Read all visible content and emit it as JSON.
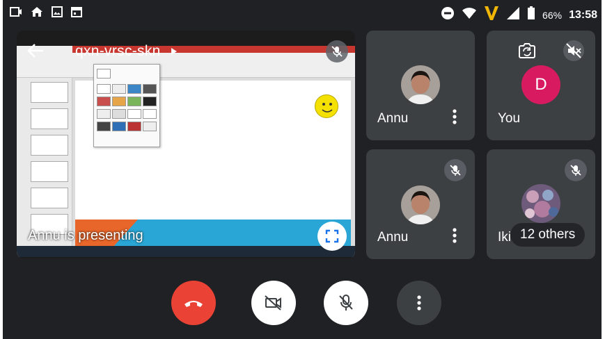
{
  "status_bar": {
    "left_icons": [
      "cast-icon",
      "home-icon",
      "gallery-icon",
      "calendar-icon"
    ],
    "right_icons": [
      "do-not-disturb-icon",
      "wifi-icon",
      "vpn-v-icon",
      "signal-icon",
      "battery-icon"
    ],
    "battery": "66%",
    "time": "13:58"
  },
  "presentation": {
    "meeting_code": "qxn-vrsc-skn",
    "presenter_label": "Annu is presenting"
  },
  "participants": [
    {
      "name": "Annu",
      "avatar": "annu-photo"
    },
    {
      "name": "You",
      "avatar_letter": "D"
    },
    {
      "name": "Annu",
      "avatar": "annu-photo"
    },
    {
      "name": "Iki",
      "others_label": "12 others"
    }
  ],
  "controls": {
    "icons": [
      "end-call-icon",
      "camera-off-icon",
      "mic-off-icon",
      "more-vert-icon"
    ]
  },
  "colors": {
    "background": "#202124",
    "tile": "#3c4043",
    "end_call": "#ea4335",
    "you_avatar": "#d81b60",
    "slide_blue": "#29a6d6",
    "slide_orange": "#e8662a"
  }
}
